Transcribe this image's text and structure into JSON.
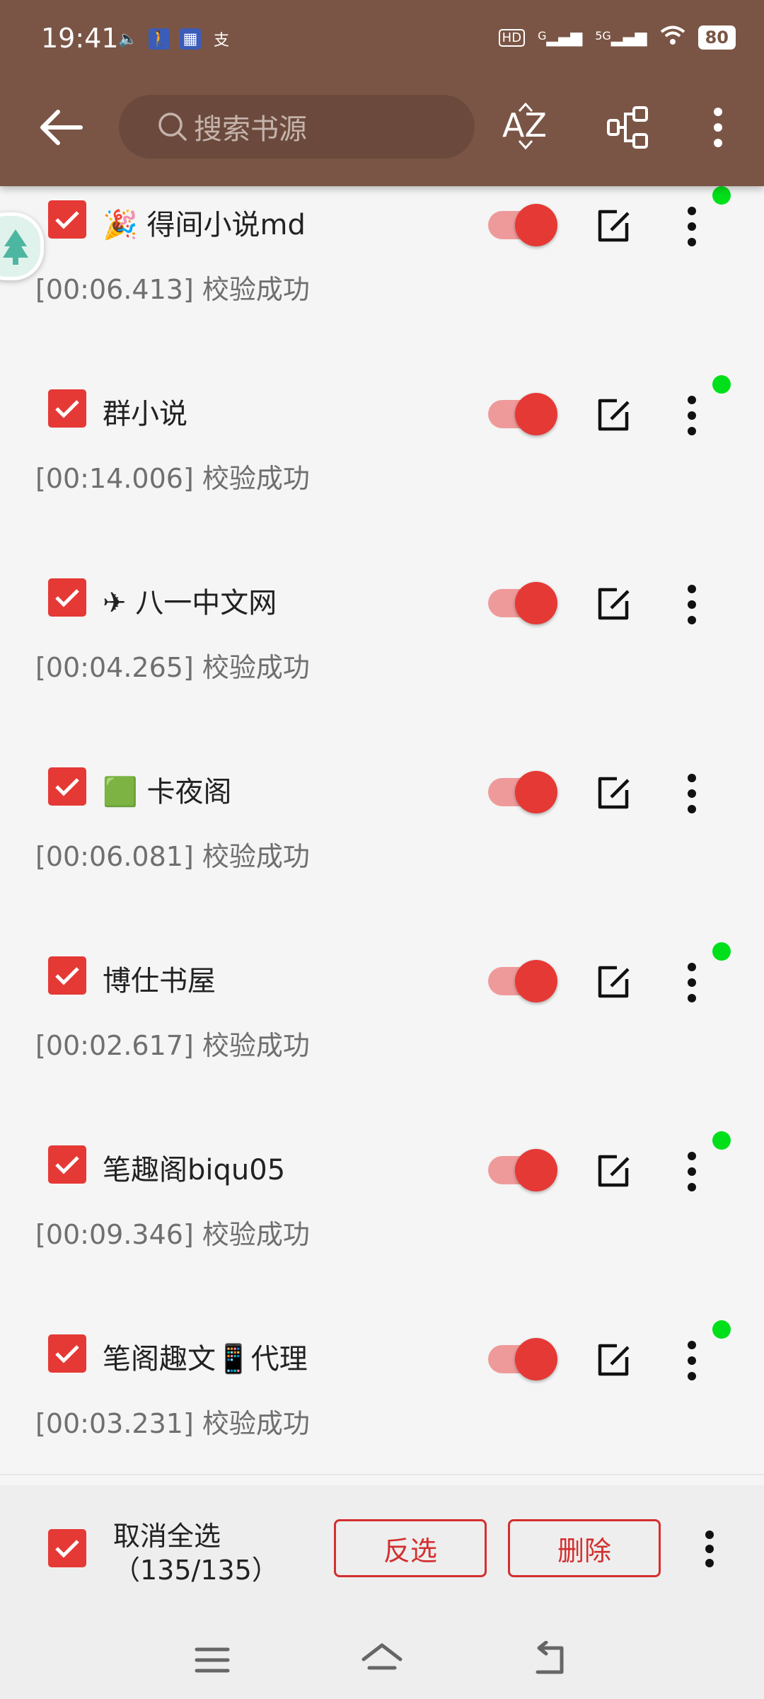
{
  "status_bar": {
    "time": "19:41",
    "net_hd": "HD",
    "net_g": "G",
    "net_5g": "5G",
    "battery": "80"
  },
  "toolbar": {
    "search_placeholder": "搜索书源",
    "sort_label": "AZ"
  },
  "sources": [
    {
      "name": "🎉 得间小说md",
      "detail": "[00:06.413] 校验成功",
      "checked": true,
      "enabled": true,
      "online_dot": true
    },
    {
      "name": "群小说",
      "detail": "[00:14.006] 校验成功",
      "checked": true,
      "enabled": true,
      "online_dot": true
    },
    {
      "name": "✈ 八一中文网",
      "detail": "[00:04.265] 校验成功",
      "checked": true,
      "enabled": true,
      "online_dot": false
    },
    {
      "name": "🟩 卡夜阁",
      "detail": "[00:06.081] 校验成功",
      "checked": true,
      "enabled": true,
      "online_dot": false
    },
    {
      "name": "博仕书屋",
      "detail": "[00:02.617] 校验成功",
      "checked": true,
      "enabled": true,
      "online_dot": true
    },
    {
      "name": "笔趣阁biqu05",
      "detail": "[00:09.346] 校验成功",
      "checked": true,
      "enabled": true,
      "online_dot": true
    },
    {
      "name": "笔阁趣文📱代理",
      "detail": "[00:03.231] 校验成功",
      "checked": true,
      "enabled": true,
      "online_dot": true
    }
  ],
  "bottom_bar": {
    "select_label_line1": "取消全选",
    "select_label_line2": "（135/135）",
    "invert_label": "反选",
    "delete_label": "删除"
  },
  "colors": {
    "toolbar_bg": "#7a5545",
    "accent_red": "#e53935",
    "online_green": "#00e01a"
  }
}
